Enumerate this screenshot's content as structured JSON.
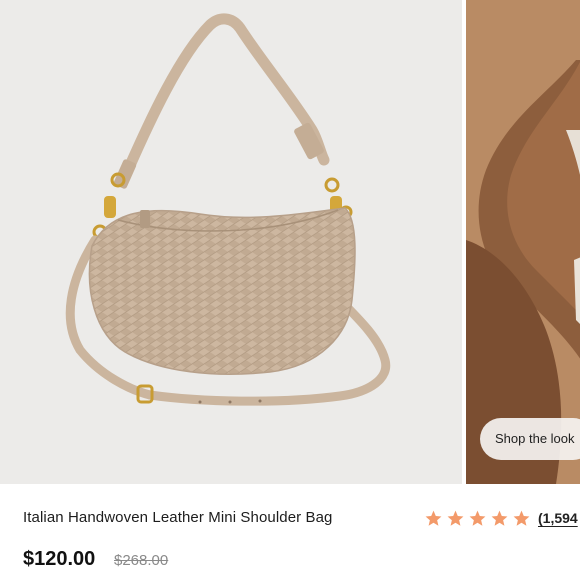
{
  "product": {
    "title": "Italian Handwoven Leather Mini Shoulder Bag",
    "price_current": "$120.00",
    "price_original": "$268.00",
    "rating": {
      "stars": 5,
      "review_count_text": "(1,594"
    }
  },
  "gallery": {
    "shop_look_label": "Shop the look"
  },
  "colors": {
    "star": "#f39a6a",
    "bag": "#c9b29b",
    "background": "#ecebe9"
  },
  "icons": [
    "star-icon"
  ]
}
